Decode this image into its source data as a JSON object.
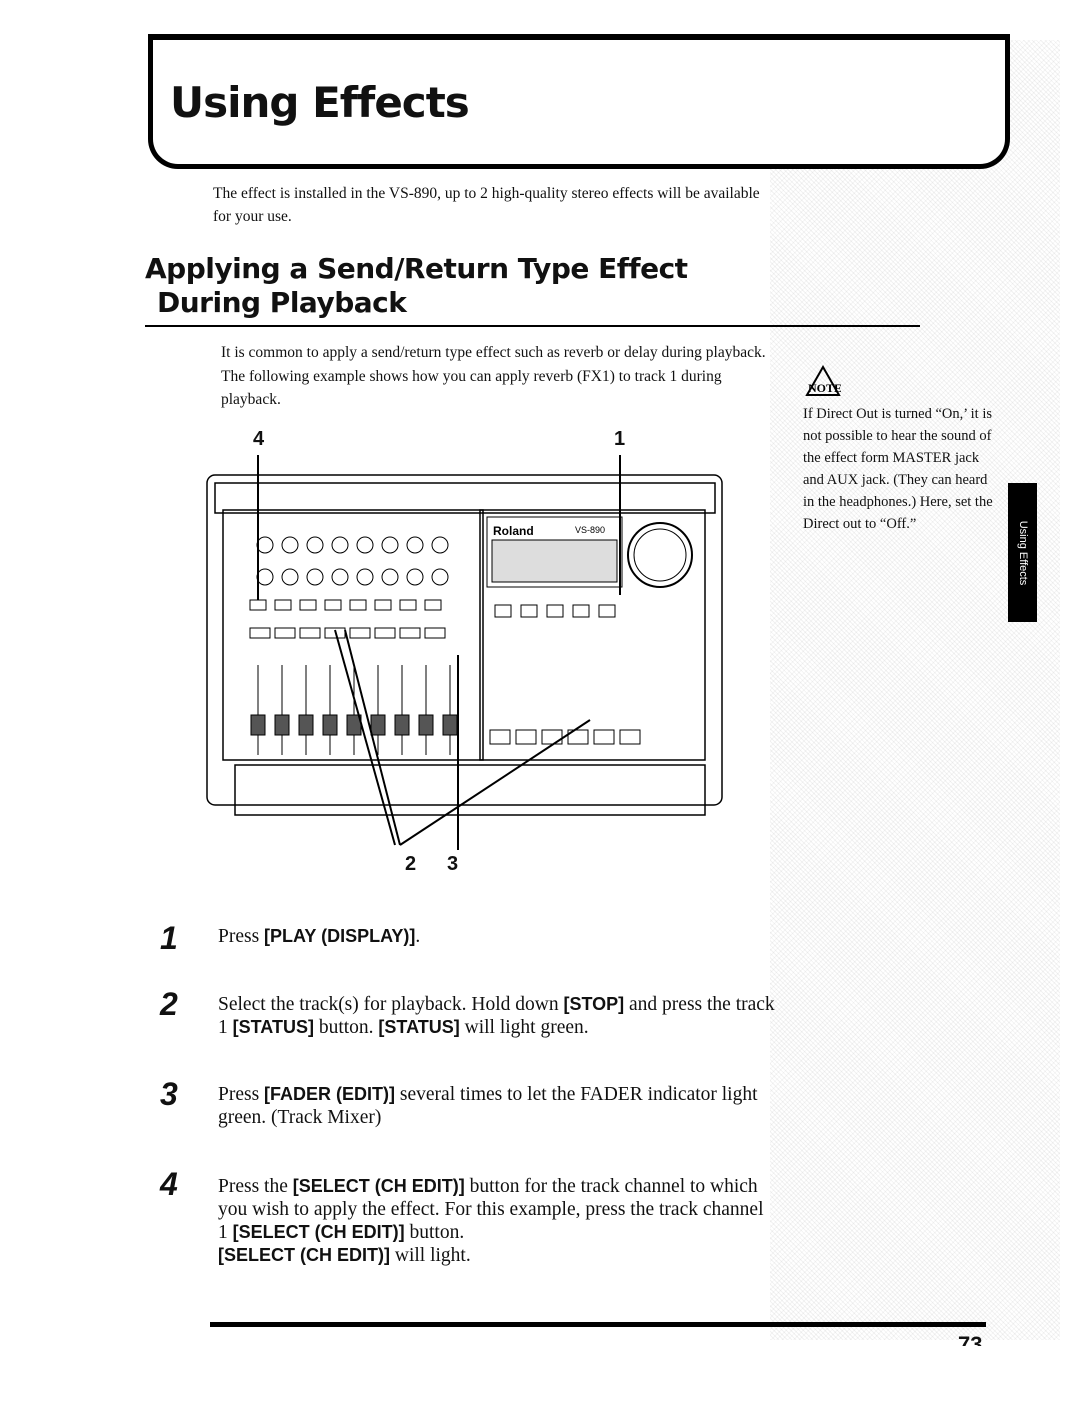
{
  "header": {
    "title": "Using Effects"
  },
  "intro": "The effect is installed in the VS-890, up to 2 high-quality stereo effects will be available for your use.",
  "section": {
    "title_line1": "Applying a Send/Return Type Effect",
    "title_line2": "During Playback",
    "paragraph": "It is common to apply a send/return type effect such as reverb or delay during playback. The following example shows how you can apply reverb (FX1) to track 1 during playback."
  },
  "figure": {
    "callouts": [
      "4",
      "1",
      "2",
      "3"
    ],
    "brand": "Roland",
    "model": "VS-890"
  },
  "steps": [
    {
      "number": "1",
      "segments": [
        {
          "t": "Press "
        },
        {
          "t": "[PLAY (DISPLAY)]",
          "b": true
        },
        {
          "t": "."
        }
      ]
    },
    {
      "number": "2",
      "segments": [
        {
          "t": "Select the track(s) for playback. Hold down "
        },
        {
          "t": "[STOP]",
          "b": true
        },
        {
          "t": " and press the track 1 "
        },
        {
          "t": "[STATUS]",
          "b": true
        },
        {
          "t": " button. "
        },
        {
          "t": "[STATUS]",
          "b": true
        },
        {
          "t": " will light green."
        }
      ]
    },
    {
      "number": "3",
      "segments": [
        {
          "t": "Press "
        },
        {
          "t": "[FADER (EDIT)]",
          "b": true
        },
        {
          "t": " several times to let the FADER indicator light green. (Track Mixer)"
        }
      ]
    },
    {
      "number": "4",
      "segments": [
        {
          "t": "Press the "
        },
        {
          "t": "[SELECT (CH EDIT)]",
          "b": true
        },
        {
          "t": " button for the track channel to which you wish to apply the effect. For this example, press the track channel 1 "
        },
        {
          "t": "[SELECT (CH EDIT)]",
          "b": true
        },
        {
          "t": " button."
        },
        {
          "br": true
        },
        {
          "t": "[SELECT (CH EDIT)]",
          "b": true
        },
        {
          "t": " will light."
        }
      ]
    }
  ],
  "note": {
    "icon": "note-icon",
    "label": "NOTE",
    "text": "If Direct Out is turned “On,’ it is not possible to hear the sound of the effect form MASTER jack and AUX jack. (They can heard in the headphones.) Here, set the Direct out to “Off.”"
  },
  "side_tab": "Using Effects",
  "page_number": "73"
}
